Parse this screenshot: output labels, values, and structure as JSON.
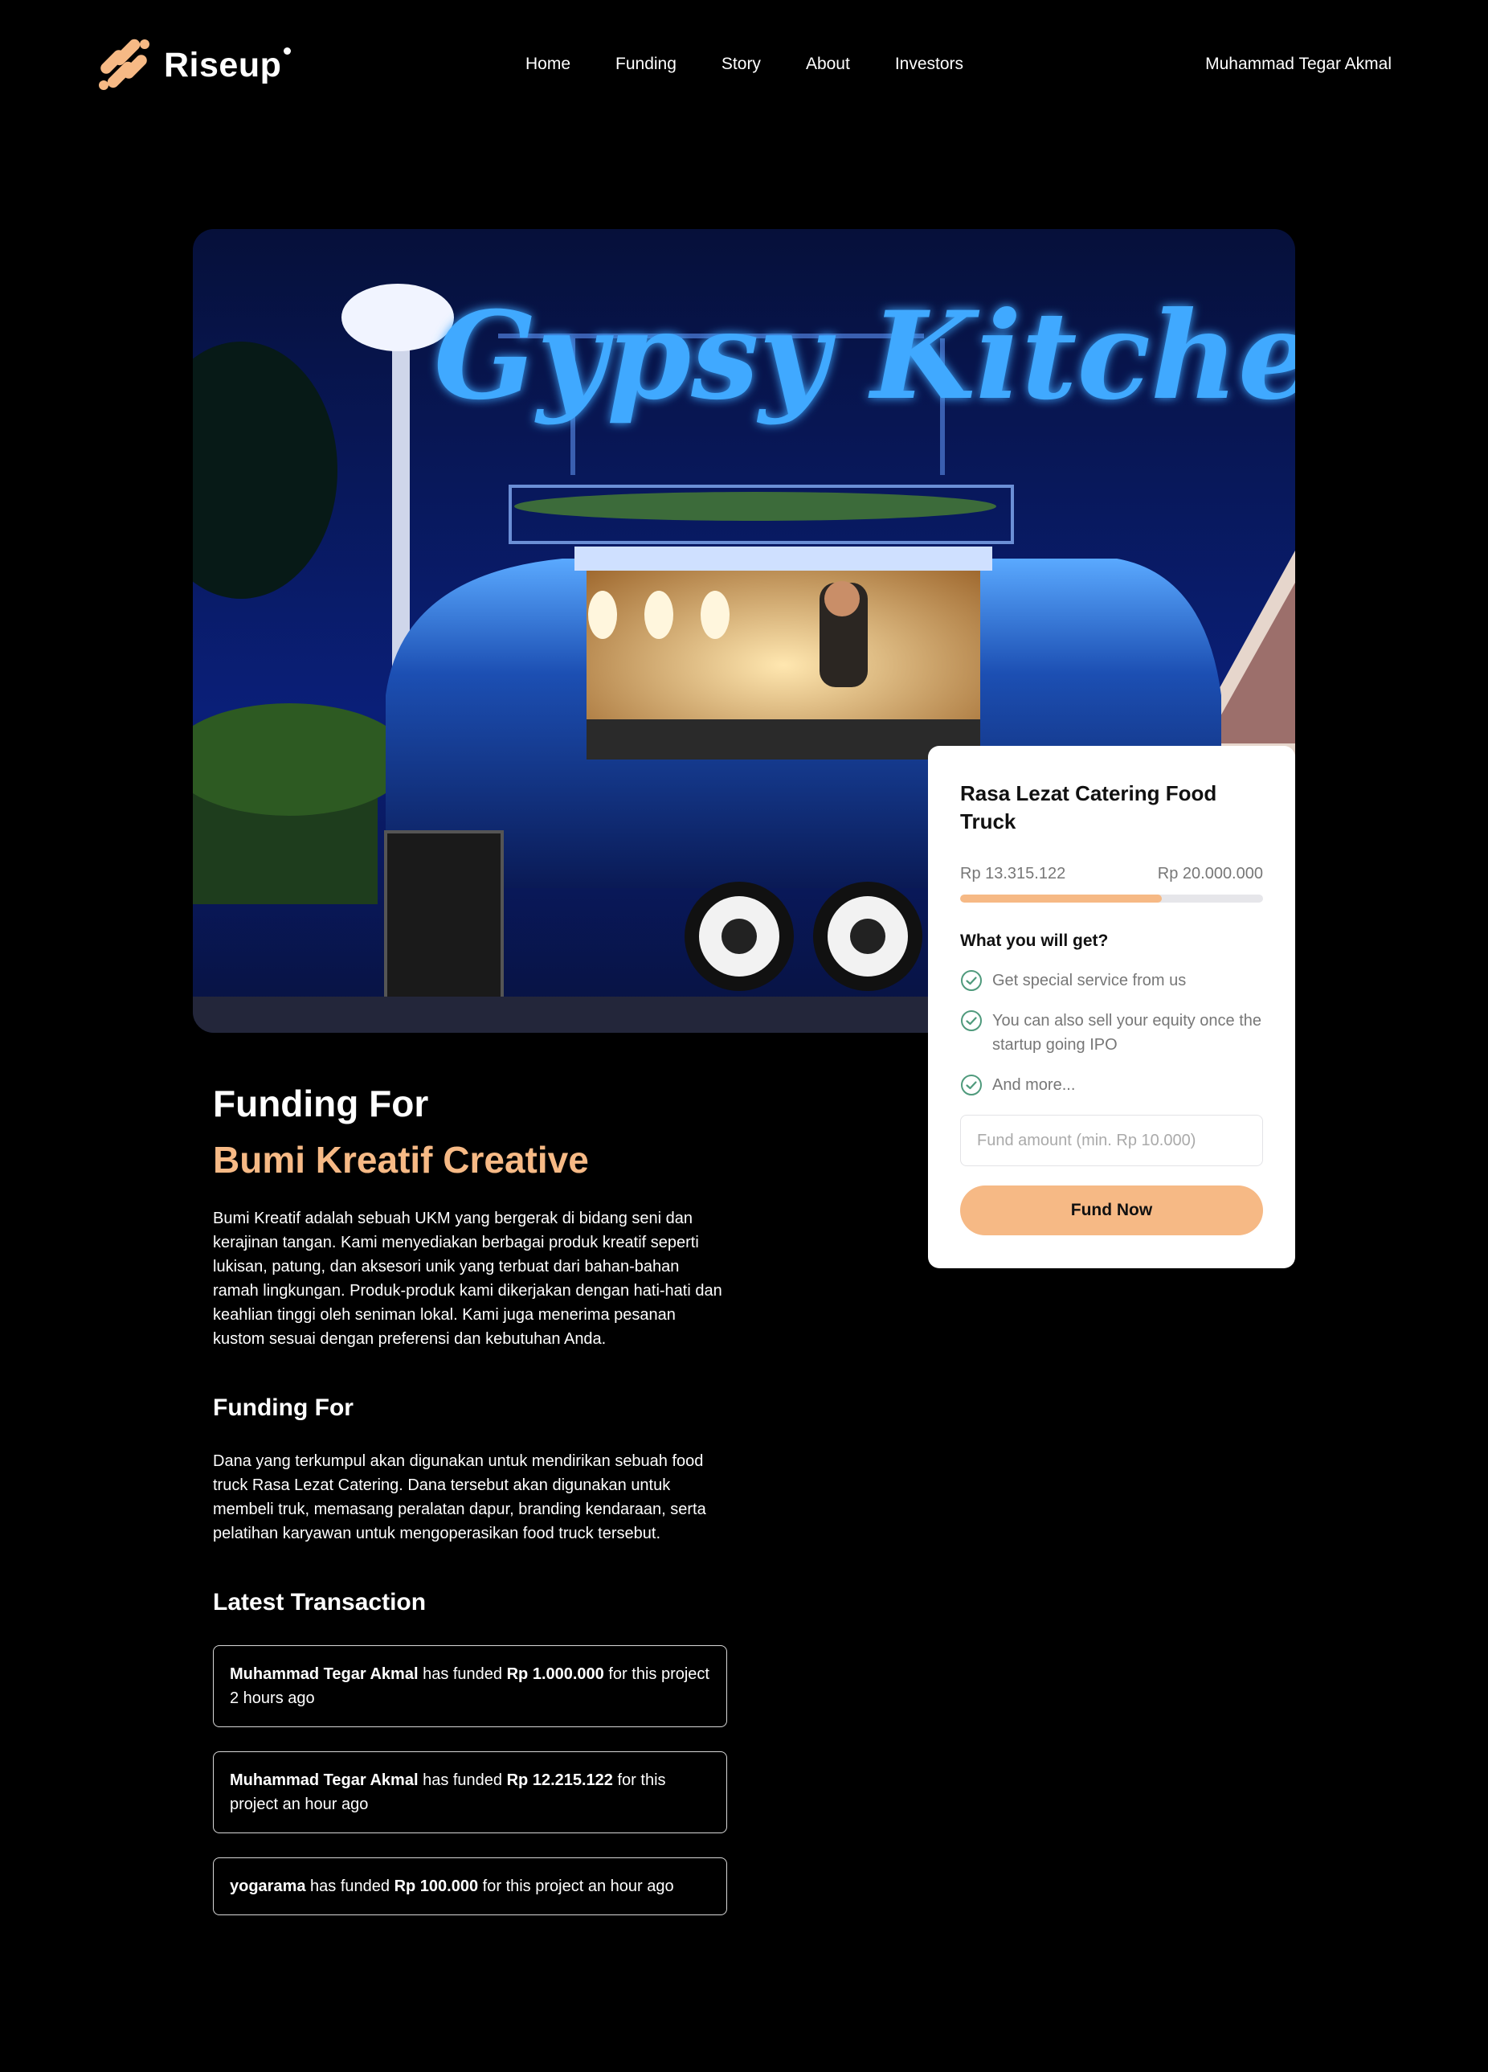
{
  "brand": {
    "name": "Riseup",
    "accent": "#f6b985"
  },
  "nav": {
    "items": [
      {
        "label": "Home"
      },
      {
        "label": "Funding"
      },
      {
        "label": "Story"
      },
      {
        "label": "About"
      },
      {
        "label": "Investors"
      }
    ],
    "user_name": "Muhammad Tegar Akmal"
  },
  "hero": {
    "sign_text": "Gypsy Kitchen"
  },
  "card": {
    "title": "Rasa Lezat Catering Food Truck",
    "raised": "Rp 13.315.122",
    "target": "Rp 20.000.000",
    "progress_fraction": 0.666,
    "benefits_title": "What you will get?",
    "benefits": [
      {
        "text": "Get special service from us"
      },
      {
        "text": "You can also sell your equity once the startup going IPO"
      },
      {
        "text": "And more..."
      }
    ],
    "input_placeholder": "Fund amount (min. Rp 10.000)",
    "button_label": "Fund Now"
  },
  "content": {
    "heading": "Funding For",
    "company": "Bumi Kreatif Creative",
    "description": "Bumi Kreatif adalah sebuah UKM yang bergerak di bidang seni dan kerajinan tangan. Kami menyediakan berbagai produk kreatif seperti lukisan, patung, dan aksesori unik yang terbuat dari bahan-bahan ramah lingkungan. Produk-produk kami dikerjakan dengan hati-hati dan keahlian tinggi oleh seniman lokal. Kami juga menerima pesanan kustom sesuai dengan preferensi dan kebutuhan Anda.",
    "funding_heading": "Funding For",
    "funding_description": "Dana yang terkumpul akan digunakan untuk mendirikan sebuah food truck Rasa Lezat Catering. Dana tersebut akan digunakan untuk membeli truk, memasang peralatan dapur, branding kendaraan, serta pelatihan karyawan untuk mengoperasikan food truck tersebut.",
    "transactions_heading": "Latest Transaction",
    "transactions": [
      {
        "name": "Muhammad Tegar Akmal",
        "verb": " has funded ",
        "amount": "Rp 1.000.000",
        "suffix": " for this project 2 hours ago"
      },
      {
        "name": "Muhammad Tegar Akmal",
        "verb": " has funded ",
        "amount": "Rp 12.215.122",
        "suffix": " for this project an hour ago"
      },
      {
        "name": "yogarama",
        "verb": " has funded ",
        "amount": "Rp 100.000",
        "suffix": " for this project an hour ago"
      }
    ]
  }
}
